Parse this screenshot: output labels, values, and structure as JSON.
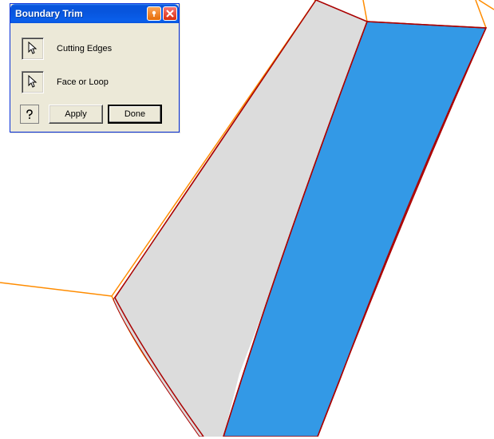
{
  "dialog": {
    "title": "Boundary Trim",
    "options": {
      "cutting_edges": "Cutting Edges",
      "face_or_loop": "Face or Loop"
    },
    "buttons": {
      "help": "?",
      "apply": "Apply",
      "done": "Done"
    },
    "titlebar_icons": {
      "pin": "pin-icon",
      "close": "close-icon"
    }
  },
  "colors": {
    "wire_orange": "#ff8c00",
    "wire_red": "#aa0000",
    "face_blue": "#3399e6",
    "face_grey": "#dcdcdc",
    "bg": "#ffffff"
  }
}
